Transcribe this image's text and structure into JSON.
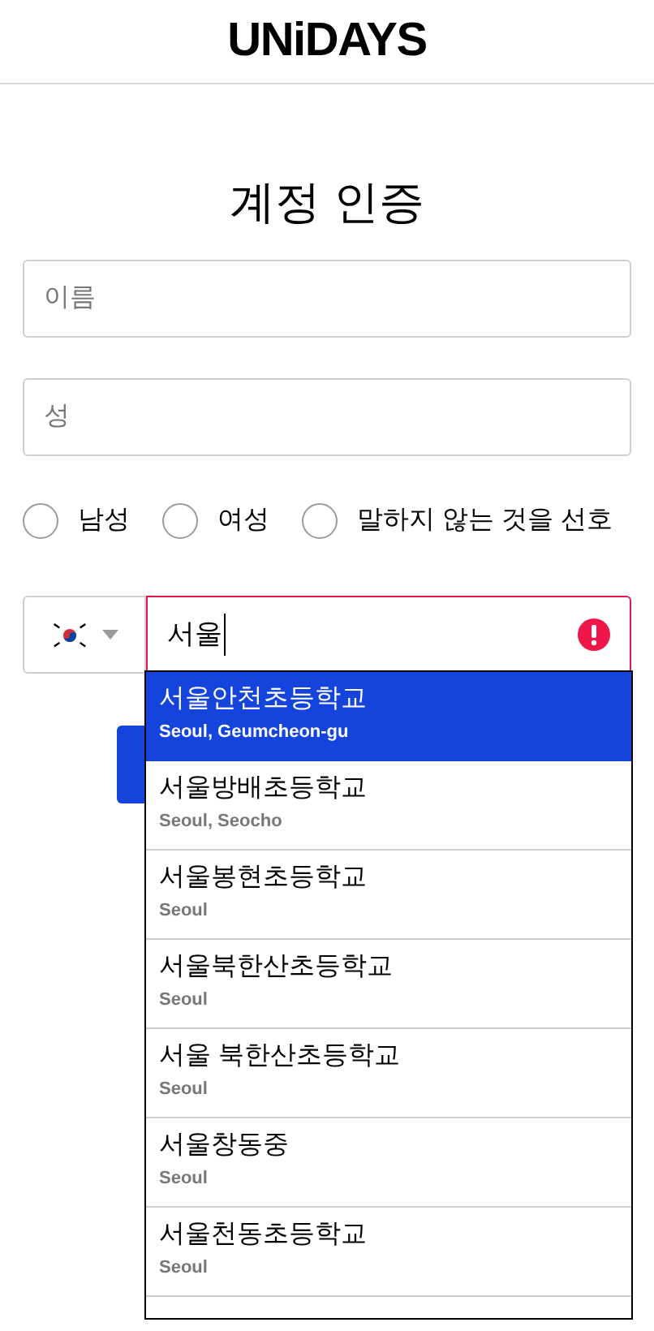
{
  "logo": "UNiDAYS",
  "title": "계정 인증",
  "fields": [
    {
      "placeholder": "이름"
    },
    {
      "placeholder": "성"
    }
  ],
  "gender": [
    {
      "label": "남성",
      "selected": false
    },
    {
      "label": "여성",
      "selected": false
    },
    {
      "label": "말하지 않는 것을 선호",
      "selected": false
    }
  ],
  "school_search": {
    "value": "서울",
    "error": true
  },
  "suggestions": [
    {
      "name": "서울안천초등학교",
      "location": "Seoul, Geumcheon-gu",
      "selected": true
    },
    {
      "name": "서울방배초등학교",
      "location": "Seoul, Seocho",
      "selected": false
    },
    {
      "name": "서울봉현초등학교",
      "location": "Seoul",
      "selected": false
    },
    {
      "name": "서울북한산초등학교",
      "location": "Seoul",
      "selected": false
    },
    {
      "name": "서울 북한산초등학교",
      "location": "Seoul",
      "selected": false
    },
    {
      "name": "서울창동중",
      "location": "Seoul",
      "selected": false
    },
    {
      "name": "서울천동초등학교",
      "location": "Seoul",
      "selected": false
    }
  ]
}
